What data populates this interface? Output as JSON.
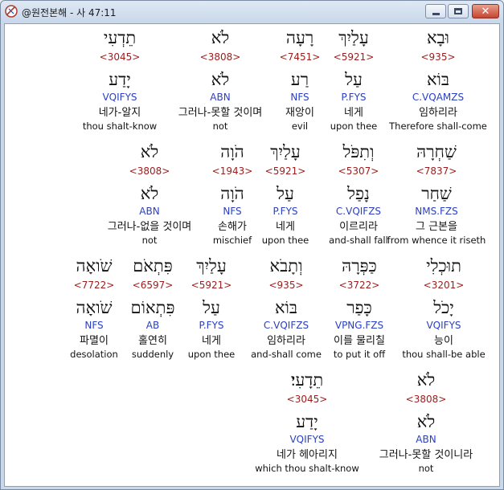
{
  "window": {
    "title": "@원전본해 - 사 47:11"
  },
  "rows": [
    {
      "words": [
        {
          "hebrew": "וּבָא",
          "strong": "<935>",
          "root": "בּוֹא",
          "morph": "C.VQAMZS",
          "korean": "임하리라",
          "english": "Therefore shall-come",
          "selected": true
        },
        {
          "hebrew": "עָלַיִךְ",
          "strong": "<5921>",
          "root": "עַל",
          "morph": "P.FYS",
          "korean": "네게",
          "english": "upon thee"
        },
        {
          "hebrew": "רָעָה",
          "strong": "<7451>",
          "root": "רַע",
          "morph": "NFS",
          "korean": "재앙이",
          "english": "evil"
        },
        {
          "hebrew": "לֹא",
          "strong": "<3808>",
          "root": "לֹא",
          "morph": "ABN",
          "korean": "그러나-못할 것이며",
          "english": "not"
        },
        {
          "hebrew": "תֵדְעִי",
          "strong": "<3045>",
          "root": "יָדַע",
          "morph": "VQIFYS",
          "korean": "네가-알지",
          "english": "thou shalt-know"
        }
      ]
    },
    {
      "words": [
        {
          "hebrew": "שַׁחְרָהּ",
          "strong": "<7837>",
          "root": "שַׁחַר",
          "morph": "NMS.FZS",
          "korean": "그 근본을",
          "english": "from whence it riseth"
        },
        {
          "hebrew": "וְתִפֹּל",
          "strong": "<5307>",
          "root": "נָפַל",
          "morph": "C.VQIFZS",
          "korean": "이르리라",
          "english": "and-shall fall"
        },
        {
          "hebrew": "עָלַיִךְ",
          "strong": "<5921>",
          "root": "עַל",
          "morph": "P.FYS",
          "korean": "네게",
          "english": "upon thee"
        },
        {
          "hebrew": "הֹוָה",
          "strong": "<1943>",
          "root": "הֹוָה",
          "morph": "NFS",
          "korean": "손해가",
          "english": "mischief"
        },
        {
          "hebrew": "לֹא",
          "strong": "<3808>",
          "root": "לֹא",
          "morph": "ABN",
          "korean": "그러나-없을 것이며",
          "english": "not"
        }
      ]
    },
    {
      "words": [
        {
          "hebrew": "תוּכְלִי",
          "strong": "<3201>",
          "root": "יָכֹל",
          "morph": "VQIFYS",
          "korean": "능이",
          "english": "thou shall-be able"
        },
        {
          "hebrew": "כַּפְּרָהּ",
          "strong": "<3722>",
          "root": "כָּפַר",
          "morph": "VPNG.FZS",
          "korean": "이를 물리칠",
          "english": "to put it off"
        },
        {
          "hebrew": "וְתָבֹא",
          "strong": "<935>",
          "root": "בּוֹא",
          "morph": "C.VQIFZS",
          "korean": "임하리라",
          "english": "and-shall come"
        },
        {
          "hebrew": "עָלַיִךְ",
          "strong": "<5921>",
          "root": "עַל",
          "morph": "P.FYS",
          "korean": "네게",
          "english": "upon thee"
        },
        {
          "hebrew": "פִּתְאֹם",
          "strong": "<6597>",
          "root": "פִּתְאוֹם",
          "morph": "AB",
          "korean": "홀연히",
          "english": "suddenly"
        },
        {
          "hebrew": "שֹׁואָה",
          "strong": "<7722>",
          "root": "שֹׁואָה",
          "morph": "NFS",
          "korean": "파멸이",
          "english": "desolation"
        }
      ]
    },
    {
      "words": [
        {
          "hebrew": "לֹא",
          "strong": "<3808>",
          "root": "לֹא",
          "morph": "ABN",
          "korean": "그러나-못할 것이니라",
          "english": "not"
        },
        {
          "hebrew": "תֵדָעִי׃",
          "strong": "<3045>",
          "root": "יָדַע",
          "morph": "VQIFYS",
          "korean": "네가 헤아리지",
          "english": "which thou shalt-know"
        }
      ]
    }
  ]
}
